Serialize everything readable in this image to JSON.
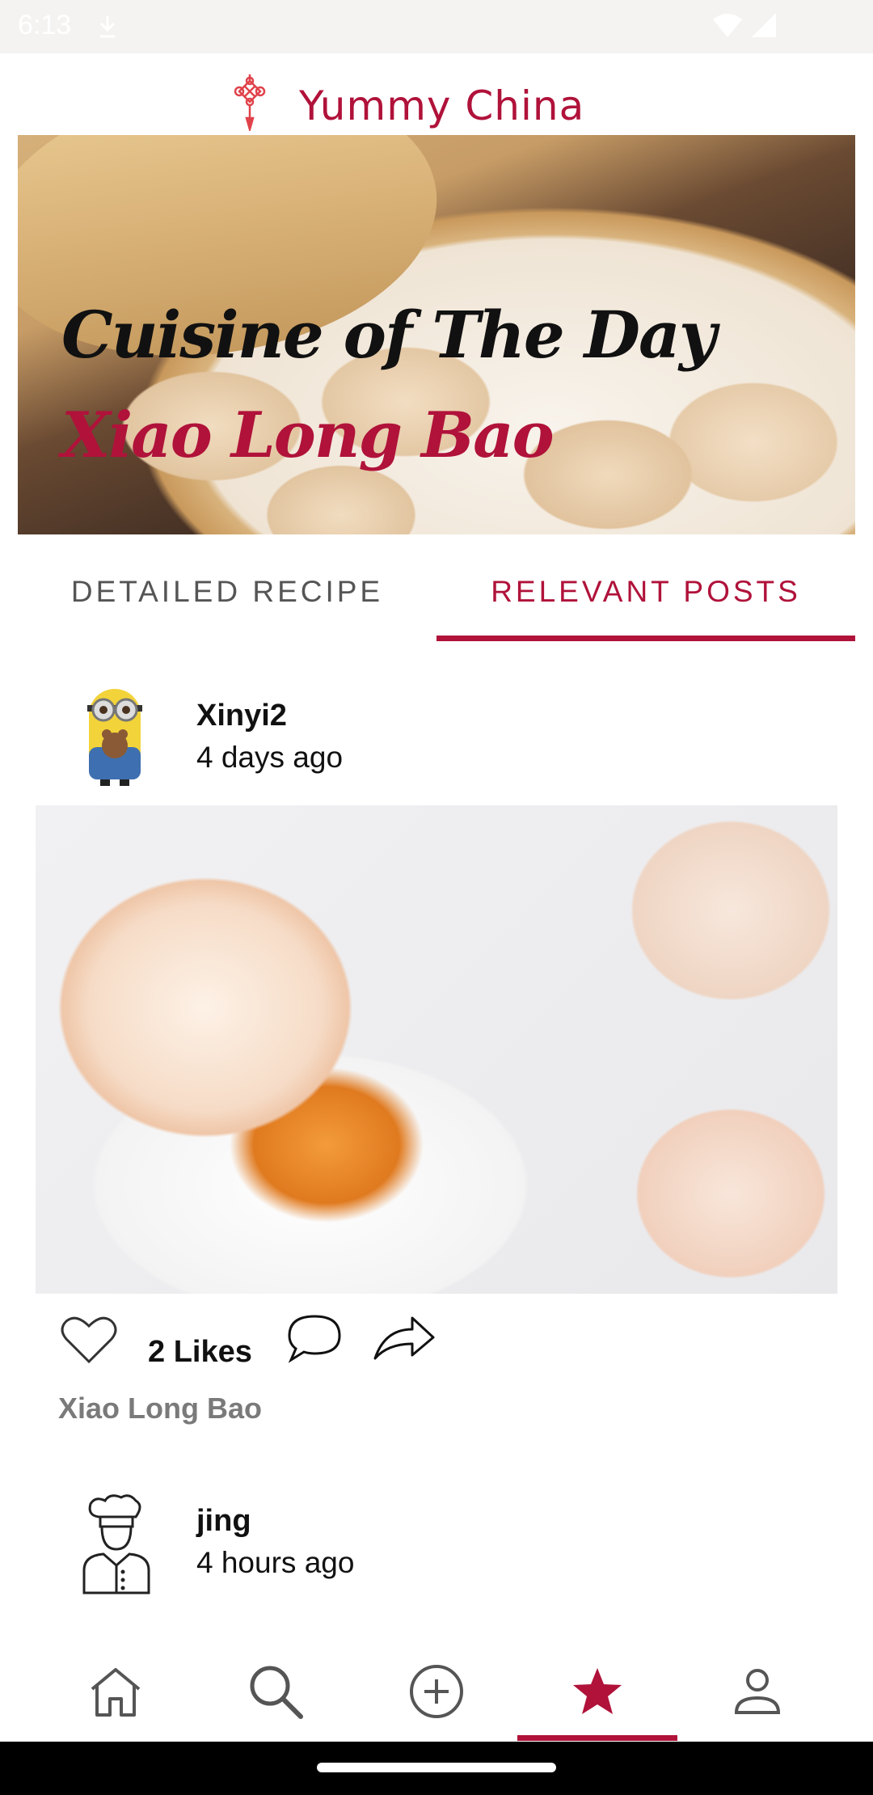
{
  "status_bar": {
    "time": "6:13",
    "icons": [
      "download-icon",
      "wifi-icon",
      "signal-icon"
    ]
  },
  "header": {
    "title": "Yummy China",
    "logo": "chinese-knot-icon"
  },
  "hero": {
    "title": "Cuisine of The Day",
    "subtitle": "Xiao Long Bao"
  },
  "tabs": [
    {
      "label": "DETAILED RECIPE",
      "selected": false
    },
    {
      "label": "RELEVANT POSTS",
      "selected": true
    }
  ],
  "posts": [
    {
      "user": "Xinyi2",
      "time": "4 days ago",
      "avatar": "minion-avatar",
      "likes_label": "2 Likes",
      "caption": "Xiao Long Bao"
    },
    {
      "user": "jing",
      "time": "4 hours ago",
      "avatar": "chef-avatar-icon"
    }
  ],
  "post_actions": [
    "heart-icon",
    "comment-icon",
    "share-icon"
  ],
  "bottom_nav": [
    {
      "icon": "home-icon",
      "selected": false
    },
    {
      "icon": "search-icon",
      "selected": false
    },
    {
      "icon": "add-circle-icon",
      "selected": false
    },
    {
      "icon": "star-icon",
      "selected": true
    },
    {
      "icon": "person-icon",
      "selected": false
    }
  ],
  "colors": {
    "accent": "#b0123a",
    "text": "#111111",
    "muted": "#7a7a7a"
  }
}
